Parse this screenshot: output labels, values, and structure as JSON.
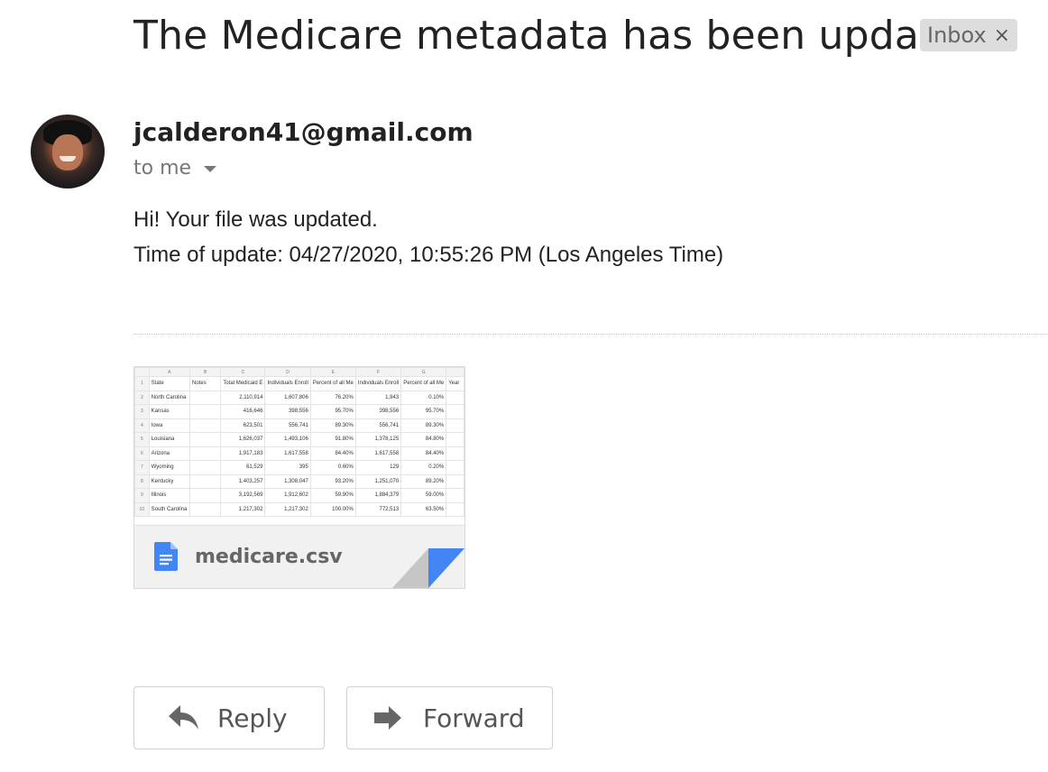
{
  "email": {
    "subject": "The Medicare metadata has been updated",
    "label": "Inbox",
    "label_close": "×",
    "sender": "jcalderon41@gmail.com",
    "recipient": "to me",
    "body_line1": "Hi! Your file was updated.",
    "body_line2": "Time of update: 04/27/2020, 10:55:26 PM (Los Angeles Time)"
  },
  "attachment": {
    "file_name": "medicare.csv",
    "icon": "google-docs-icon",
    "preview": {
      "column_letters": [
        "A",
        "B",
        "C",
        "D",
        "E",
        "F",
        "G",
        ""
      ],
      "headers": [
        "State",
        "Notes",
        "Total Medicaid E",
        "Individuals Enroll",
        "Percent of all Me",
        "Individuals Enroll",
        "Percent of all Me",
        "Year"
      ],
      "rows": [
        [
          "North Carolina",
          "",
          "2,110,914",
          "1,607,806",
          "76.20%",
          "1,943",
          "0.10%",
          ""
        ],
        [
          "Kansas",
          "",
          "416,646",
          "398,556",
          "95.70%",
          "398,556",
          "95.70%",
          ""
        ],
        [
          "Iowa",
          "",
          "623,501",
          "556,741",
          "89.30%",
          "556,741",
          "89.30%",
          ""
        ],
        [
          "Louisiana",
          "",
          "1,626,037",
          "1,493,106",
          "91.80%",
          "1,378,125",
          "84.80%",
          ""
        ],
        [
          "Arizona",
          "",
          "1,917,183",
          "1,617,558",
          "84.40%",
          "1,617,558",
          "84.40%",
          ""
        ],
        [
          "Wyoming",
          "",
          "61,529",
          "395",
          "0.60%",
          "129",
          "0.20%",
          ""
        ],
        [
          "Kentucky",
          "",
          "1,403,257",
          "1,308,047",
          "93.20%",
          "1,251,070",
          "89.20%",
          ""
        ],
        [
          "Illinois",
          "",
          "3,192,569",
          "1,912,602",
          "59.90%",
          "1,884,379",
          "59.00%",
          ""
        ],
        [
          "South Carolina",
          "",
          "1,217,302",
          "1,217,302",
          "100.00%",
          "772,513",
          "63.50%",
          ""
        ]
      ]
    }
  },
  "actions": {
    "reply_label": "Reply",
    "forward_label": "Forward"
  },
  "colors": {
    "accent_blue": "#4285f4",
    "chip_bg": "#dddddd"
  }
}
